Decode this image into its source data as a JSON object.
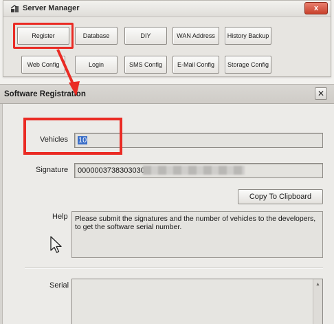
{
  "server_manager": {
    "title": "Server Manager",
    "close_label": "x",
    "buttons_row1": [
      "Register",
      "Database",
      "DIY",
      "WAN Address",
      "History Backup"
    ],
    "buttons_row2": [
      "Web Config",
      "Login",
      "SMS Config",
      "E-Mail Config",
      "Storage Config"
    ]
  },
  "dialog": {
    "title": "Software Registration",
    "close_label": "✕",
    "vehicles_label": "Vehicles",
    "vehicles_value": "10",
    "signature_label": "Signature",
    "signature_value": "0000003738303030",
    "copy_button": "Copy To Clipboard",
    "help_label": "Help",
    "help_text": "Please submit the signatures and the number of vehicles to the developers, to get the software serial number.",
    "serial_label": "Serial",
    "serial_value": ""
  },
  "colors": {
    "highlight": "#ea2b24",
    "selection": "#3a6ec8"
  }
}
